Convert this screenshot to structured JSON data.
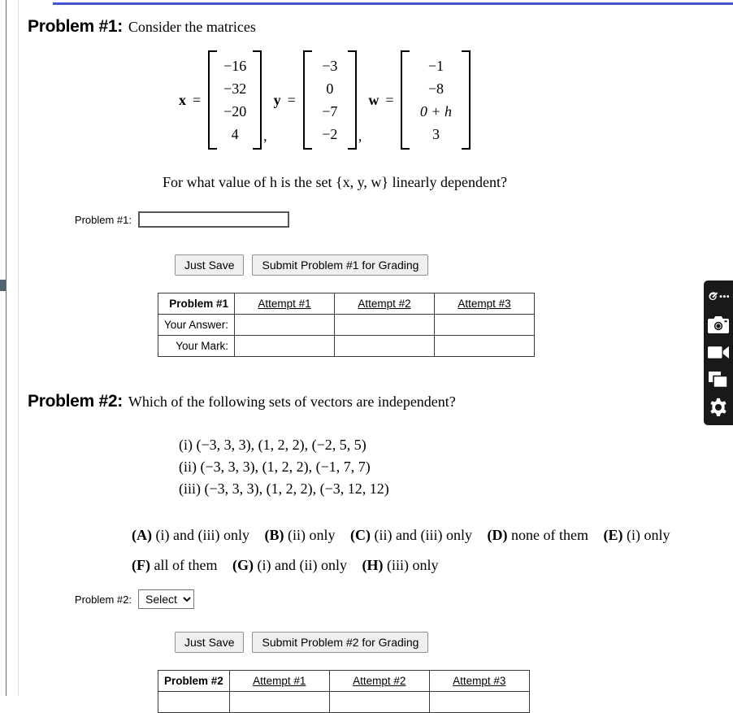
{
  "page": {
    "accent_color": "#4355cc",
    "toolbar_bg": "#191919"
  },
  "problems": [
    {
      "label": "Problem #1:",
      "prompt": "Consider the matrices",
      "matrices": [
        {
          "name": "x",
          "eq": "=",
          "entries": [
            "−16",
            "−32",
            "−20",
            "4"
          ],
          "sep": ","
        },
        {
          "name": "y",
          "eq": "=",
          "entries": [
            "−3",
            "0",
            "−7",
            "−2"
          ],
          "sep": ","
        },
        {
          "name": "w",
          "eq": "=",
          "entries": [
            "−1",
            "−8",
            "0 + h",
            "3"
          ],
          "sep": ""
        }
      ],
      "question": "For what value of h is the set {x, y, w} linearly dependent?",
      "answer_label": "Problem #1:",
      "answer_value": "",
      "answer_placeholder": "",
      "save_label": "Just Save",
      "submit_label": "Submit Problem #1 for Grading",
      "table": {
        "corner": "Problem #1",
        "columns": [
          "Attempt #1",
          "Attempt #2",
          "Attempt #3"
        ],
        "rows": [
          {
            "header": "Your Answer:",
            "cells": [
              "",
              "",
              ""
            ]
          },
          {
            "header": "Your Mark:",
            "cells": [
              "",
              "",
              ""
            ]
          }
        ]
      }
    },
    {
      "label": "Problem #2:",
      "prompt": "Which of the following sets of vectors are independent?",
      "vector_sets": [
        "(i) (−3, 3, 3), (1, 2, 2), (−2, 5, 5)",
        "(ii) (−3, 3, 3), (1, 2, 2), (−1, 7, 7)",
        "(iii) (−3, 3, 3), (1, 2, 2), (−3, 12, 12)"
      ],
      "choices_row1": [
        {
          "key": "(A)",
          "text": "(i) and (iii) only"
        },
        {
          "key": "(B)",
          "text": "(ii) only"
        },
        {
          "key": "(C)",
          "text": "(ii) and (iii) only"
        },
        {
          "key": "(D)",
          "text": "none of them"
        },
        {
          "key": "(E)",
          "text": "(i) only"
        }
      ],
      "choices_row2": [
        {
          "key": "(F)",
          "text": "all of them"
        },
        {
          "key": "(G)",
          "text": "(i) and (ii) only"
        },
        {
          "key": "(H)",
          "text": "(iii) only"
        }
      ],
      "answer_label": "Problem #2:",
      "selected_option": "Select",
      "options": [
        "Select",
        "(A)",
        "(B)",
        "(C)",
        "(D)",
        "(E)",
        "(F)",
        "(G)",
        "(H)"
      ],
      "save_label": "Just Save",
      "submit_label": "Submit Problem #2 for Grading",
      "table": {
        "corner": "Problem #2",
        "columns": [
          "Attempt #1",
          "Attempt #2",
          "Attempt #3"
        ]
      }
    }
  ],
  "floating_toolbar": {
    "items": [
      {
        "icon": "comet-menu-icon"
      },
      {
        "icon": "camera-icon"
      },
      {
        "icon": "video-camera-icon"
      },
      {
        "icon": "window-icon"
      },
      {
        "icon": "gear-icon"
      }
    ]
  }
}
